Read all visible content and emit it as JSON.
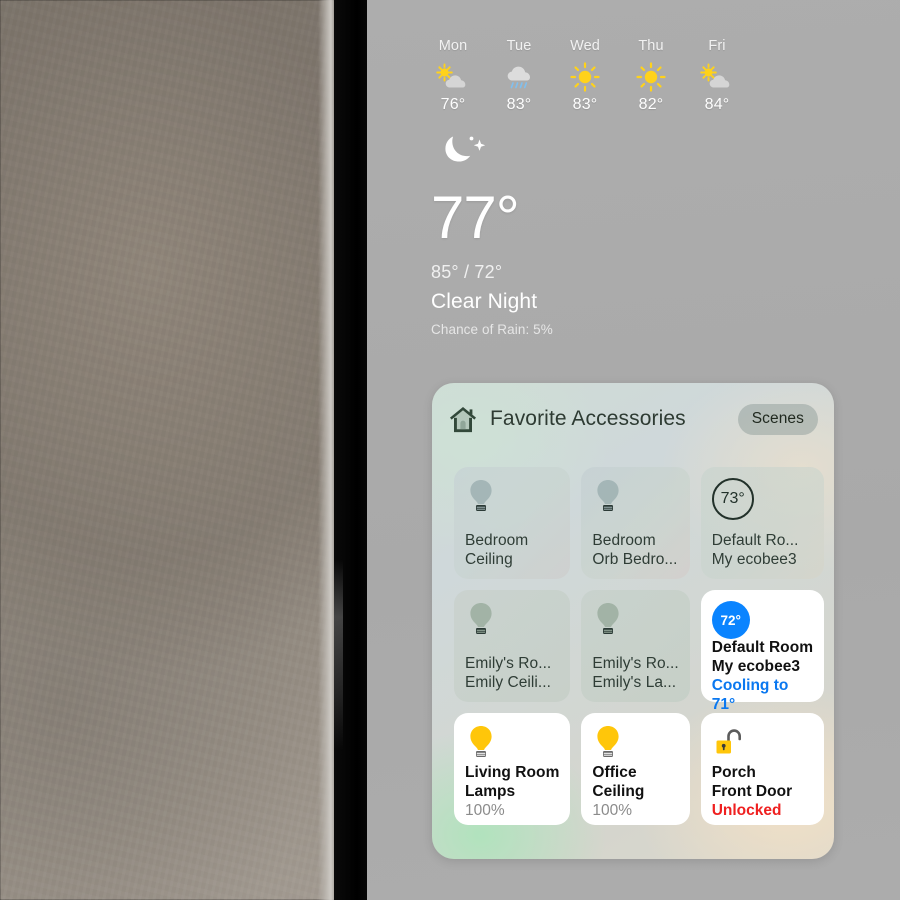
{
  "weather": {
    "forecast": [
      {
        "day": "Mon",
        "icon": "sun-behind-cloud-icon",
        "temp": "76°"
      },
      {
        "day": "Tue",
        "icon": "cloud-rain-icon",
        "temp": "83°"
      },
      {
        "day": "Wed",
        "icon": "sun-icon",
        "temp": "83°"
      },
      {
        "day": "Thu",
        "icon": "sun-icon",
        "temp": "82°"
      },
      {
        "day": "Fri",
        "icon": "sun-behind-cloud-icon",
        "temp": "84°"
      }
    ],
    "current": {
      "icon": "moon-stars-icon",
      "temperature": "77°",
      "high_low": "85° / 72°",
      "condition": "Clear Night",
      "rain_chance": "Chance of Rain: 5%"
    }
  },
  "home_card": {
    "icon": "house-icon",
    "title": "Favorite Accessories",
    "scenes_label": "Scenes",
    "tiles": [
      {
        "icon": "lightbulb-icon",
        "state": "off",
        "line1": "Bedroom",
        "line2": "Ceiling",
        "line3": ""
      },
      {
        "icon": "lightbulb-icon",
        "state": "off",
        "line1": "Bedroom",
        "line2": "Orb Bedro...",
        "line3": ""
      },
      {
        "icon": "thermostat-ring-icon",
        "state": "off",
        "badge": "73°",
        "line1": "Default Ro...",
        "line2": "My ecobee3",
        "line3": ""
      },
      {
        "icon": "lightbulb-icon",
        "state": "off",
        "line1": "Emily's Ro...",
        "line2": "Emily Ceili...",
        "line3": ""
      },
      {
        "icon": "lightbulb-icon",
        "state": "off",
        "line1": "Emily's Ro...",
        "line2": "Emily's La...",
        "line3": ""
      },
      {
        "icon": "thermostat-dot-icon",
        "state": "on",
        "badge": "72°",
        "line1": "Default Room",
        "line2": "My ecobee3",
        "line3": "Cooling to 71°"
      },
      {
        "icon": "lightbulb-on-icon",
        "state": "on",
        "line1": "Living Room",
        "line2": "Lamps",
        "line3": "100%"
      },
      {
        "icon": "lightbulb-on-icon",
        "state": "on",
        "line1": "Office",
        "line2": "Ceiling",
        "line3": "100%"
      },
      {
        "icon": "lock-open-icon",
        "state": "on",
        "line1": "Porch",
        "line2": "Front Door",
        "line3": "Unlocked"
      }
    ]
  },
  "colors": {
    "accent_blue": "#0a84ff",
    "alert_red": "#ef2020",
    "bulb_yellow": "#ffc60a",
    "card_text": "#2f3d36"
  }
}
